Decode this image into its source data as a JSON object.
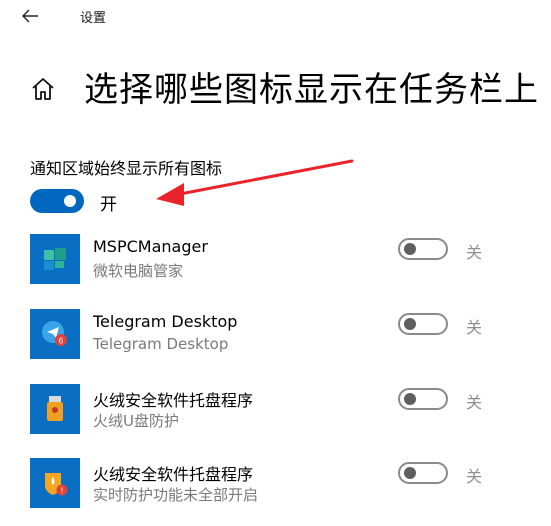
{
  "window": {
    "title": "设置"
  },
  "header": {
    "title": "选择哪些图标显示在任务栏上"
  },
  "master": {
    "label": "通知区域始终显示所有图标",
    "state": "开"
  },
  "apps": [
    {
      "name": "MSPCManager",
      "description": "微软电脑管家",
      "state": "关"
    },
    {
      "name": "Telegram Desktop",
      "description": "Telegram Desktop",
      "state": "关",
      "badge": "6"
    },
    {
      "name": "火绒安全软件托盘程序",
      "description": "火绒U盘防护",
      "state": "关"
    },
    {
      "name": "火绒安全软件托盘程序",
      "description": "实时防护功能未全部开启",
      "state": "关",
      "badge": "!"
    }
  ],
  "colors": {
    "accent": "#0067c0",
    "icon_bg": "#0a6fc2",
    "annotation_arrow": "#e8242a"
  },
  "icons": [
    "back-arrow-icon",
    "home-icon",
    "mspcmanager-icon",
    "telegram-icon",
    "huorong-usb-icon",
    "huorong-shield-icon"
  ]
}
